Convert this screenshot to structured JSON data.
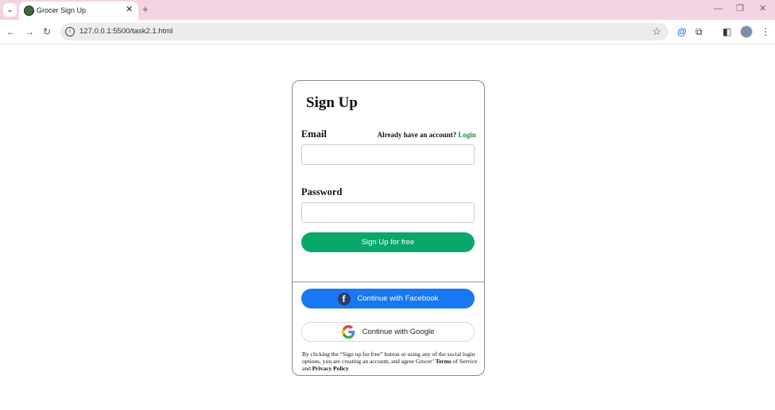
{
  "browser": {
    "tab_title": "Grocer Sign Up",
    "tab_close": "✕",
    "new_tab": "+",
    "url": "127.0.0.1:5500/task2.1.html"
  },
  "signup": {
    "title": "Sign Up",
    "email_label": "Email",
    "already_text": "Already have an account?",
    "login_link": "Login",
    "password_label": "Password",
    "email_value": "",
    "password_value": "",
    "signup_button": "Sign Up for free",
    "facebook_button": "Continue with Facebook",
    "google_button": "Continue with Google",
    "terms": {
      "prefix": "By clicking the “Sign up for free” button or using any of the social login options, you are creating an account, and agree Grocer’",
      "terms_link": "Terms",
      "middle": "of Service and",
      "privacy_link": "Privacy Policy"
    }
  },
  "colors": {
    "tabbar": "#f4d3e2",
    "signup_button": "#08a86b",
    "facebook_button": "#1877f2",
    "login_link": "#1f8a3a"
  }
}
